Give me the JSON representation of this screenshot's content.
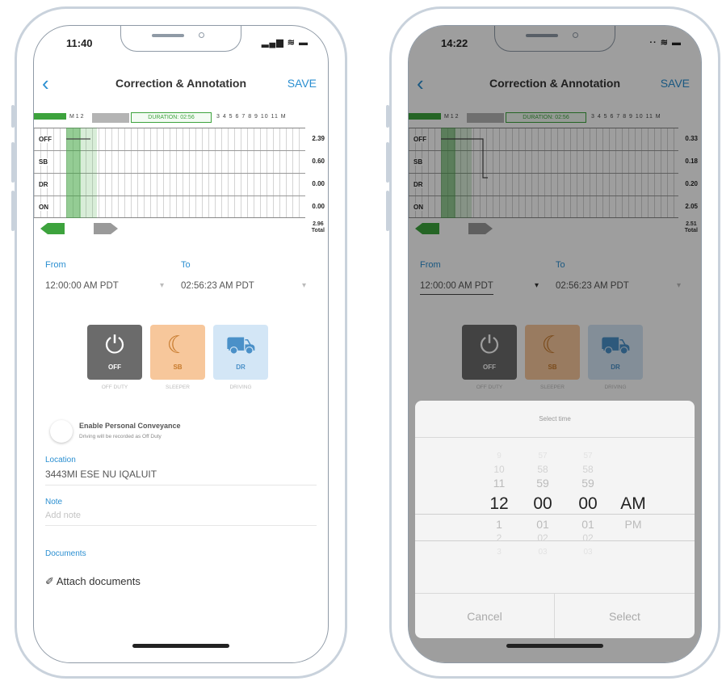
{
  "colors": {
    "accent": "#2b8fd1",
    "green": "#3da33d",
    "off": "#6b6b6b",
    "sleeper": "#f7c79b",
    "driving": "#d3e6f6"
  },
  "left": {
    "status_time": "11:40",
    "status_icons": "▂▄▆ ≋ ▬",
    "nav": {
      "back_icon": "‹",
      "title": "Correction & Annotation",
      "save": "SAVE"
    },
    "chart": {
      "timeline_left": "M 1 2",
      "timeline_duration": "DURATION: 02:56",
      "timeline_right": "3 4 5 6 7 8 9 10 11 M",
      "rows": [
        {
          "label": "OFF",
          "value": "2.39"
        },
        {
          "label": "SB",
          "value": "0.60"
        },
        {
          "label": "DR",
          "value": "0.00"
        },
        {
          "label": "ON",
          "value": "0.00"
        }
      ],
      "total_value": "2.96",
      "total_label": "Total"
    },
    "from_label": "From",
    "from_value": "12:00:00 AM PDT",
    "to_label": "To",
    "to_value": "02:56:23 AM PDT",
    "caret": "▾",
    "tiles": [
      {
        "icon": "⏻",
        "label": "OFF",
        "sub": "OFF DUTY"
      },
      {
        "icon": "☾",
        "label": "SB",
        "sub": "SLEEPER"
      },
      {
        "icon": "⛟",
        "label": "DR",
        "sub": "DRIVING"
      }
    ],
    "pc_title": "Enable Personal Conveyance",
    "pc_sub": "Driving will be recorded as Off Duty",
    "location_label": "Location",
    "location_value": "3443MI ESE NU IQALUIT",
    "note_label": "Note",
    "note_placeholder": "Add note",
    "documents_label": "Documents",
    "attach_icon": "✐",
    "attach_text": "Attach documents"
  },
  "right": {
    "status_time": "14:22",
    "status_icons": "·· ≋ ▬",
    "nav": {
      "back_icon": "‹",
      "title": "Correction & Annotation",
      "save": "SAVE"
    },
    "chart": {
      "timeline_left": "M 1 2",
      "timeline_duration": "DURATION: 02:56",
      "timeline_right": "3 4 5 6 7 8 9 10 11 M",
      "rows": [
        {
          "label": "OFF",
          "value": "0.33"
        },
        {
          "label": "SB",
          "value": "0.18"
        },
        {
          "label": "DR",
          "value": "0.20"
        },
        {
          "label": "ON",
          "value": "2.05"
        }
      ],
      "total_value": "2.51",
      "total_label": "Total"
    },
    "from_label": "From",
    "from_value": "12:00:00 AM PDT",
    "to_label": "To",
    "to_value": "02:56:23 AM PDT",
    "caret": "▾",
    "tiles": [
      {
        "icon": "⏻",
        "label": "OFF",
        "sub": "OFF DUTY"
      },
      {
        "icon": "☾",
        "label": "SB",
        "sub": "SLEEPER"
      },
      {
        "icon": "⛟",
        "label": "DR",
        "sub": "DRIVING"
      }
    ],
    "picker": {
      "title": "Select time",
      "hours": [
        "9",
        "10",
        "11",
        "12",
        "1",
        "2",
        "3"
      ],
      "minutes": [
        "57",
        "58",
        "59",
        "00",
        "01",
        "02",
        "03"
      ],
      "seconds": [
        "57",
        "58",
        "59",
        "00",
        "01",
        "02",
        "03"
      ],
      "ampm_selected": "AM",
      "ampm_other": "PM",
      "cancel": "Cancel",
      "select": "Select"
    }
  }
}
